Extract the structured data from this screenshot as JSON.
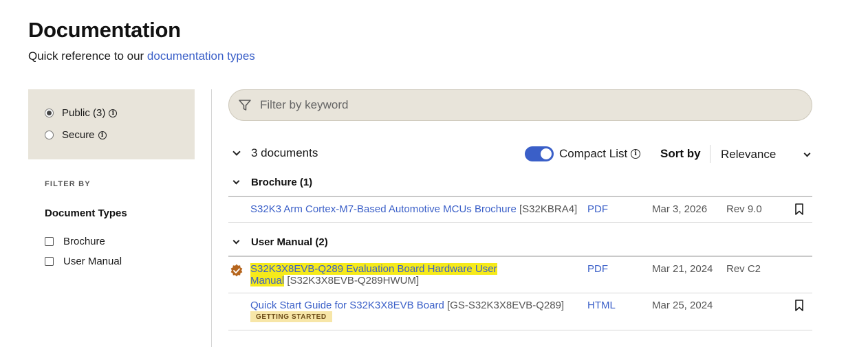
{
  "header": {
    "title": "Documentation",
    "subtitle_prefix": "Quick reference to our ",
    "subtitle_link": "documentation types"
  },
  "access": {
    "options": [
      {
        "label": "Public (3)",
        "selected": true
      },
      {
        "label": "Secure",
        "selected": false
      }
    ]
  },
  "filters": {
    "filter_by_label": "FILTER BY",
    "doc_types_heading": "Document Types",
    "doc_types": [
      {
        "label": "Brochure",
        "checked": false
      },
      {
        "label": "User Manual",
        "checked": false
      }
    ]
  },
  "search": {
    "placeholder": "Filter by keyword"
  },
  "results": {
    "count_label": "3 documents",
    "compact_list_label": "Compact List",
    "compact_list_enabled": true,
    "sort_label": "Sort by",
    "sort_value": "Relevance"
  },
  "groups": [
    {
      "heading": "Brochure (1)",
      "docs": [
        {
          "title": "S32K3 Arm Cortex-M7-Based Automotive MCUs Brochure",
          "code": "[S32KBRA4]",
          "type": "PDF",
          "date": "Mar 3, 2026",
          "rev": "Rev 9.0"
        }
      ]
    },
    {
      "heading": "User Manual (2)",
      "docs": [
        {
          "title_line1": "S32K3X8EVB-Q289 Evaluation Board Hardware User",
          "title_line2": "Manual",
          "code": "[S32K3X8EVB-Q289HWUM]",
          "type": "PDF",
          "date": "Mar 21, 2024",
          "rev": "Rev C2"
        },
        {
          "title": "Quick Start Guide for S32K3X8EVB Board",
          "code": "[GS-S32K3X8EVB-Q289]",
          "type": "HTML",
          "date": "Mar 25, 2024",
          "tag": "GETTING STARTED"
        }
      ]
    }
  ],
  "colors": {
    "accent": "#3a5fc8",
    "panel_bg": "#e8e4da",
    "highlight": "#f6ea1a",
    "tag_bg": "#f7e6a8",
    "badge": "#b5651d"
  }
}
